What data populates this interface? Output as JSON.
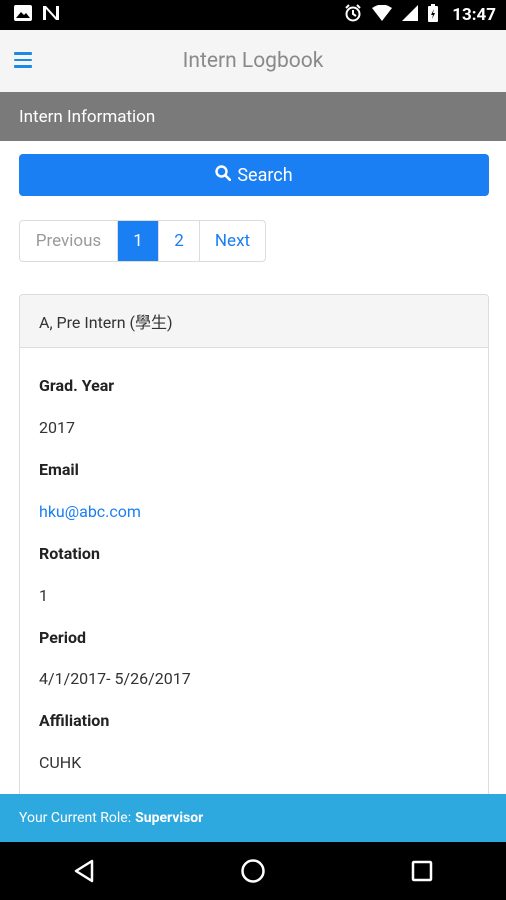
{
  "status_bar": {
    "time": "13:47",
    "left_icons": [
      "image-icon",
      "n-icon"
    ],
    "right_icons": [
      "alarm-icon",
      "wifi-icon",
      "cell-signal-icon",
      "battery-icon"
    ]
  },
  "header": {
    "title": "Intern Logbook",
    "menu_icon": "hamburger-menu-icon"
  },
  "section": {
    "title": "Intern Information"
  },
  "search": {
    "label": "Search",
    "icon": "search-icon"
  },
  "pagination": {
    "previous": "Previous",
    "pages": [
      "1",
      "2"
    ],
    "active_page": "1",
    "next": "Next"
  },
  "card": {
    "title": "A, Pre Intern (學生)",
    "fields": [
      {
        "label": "Grad. Year",
        "value": "2017"
      },
      {
        "label": "Email",
        "value": "hku@abc.com"
      },
      {
        "label": "Rotation",
        "value": "1"
      },
      {
        "label": "Period",
        "value": "4/1/2017- 5/26/2017"
      },
      {
        "label": "Affiliation",
        "value": "CUHK"
      }
    ]
  },
  "role_bar": {
    "prefix": "Your Current Role:",
    "role": "Supervisor"
  },
  "nav_bar": {
    "icons": [
      "back-icon",
      "home-icon",
      "recents-icon"
    ]
  },
  "colors": {
    "primary": "#1a7ff2",
    "section_bar": "#7a7a7a",
    "role_bar": "#2ea9df"
  }
}
